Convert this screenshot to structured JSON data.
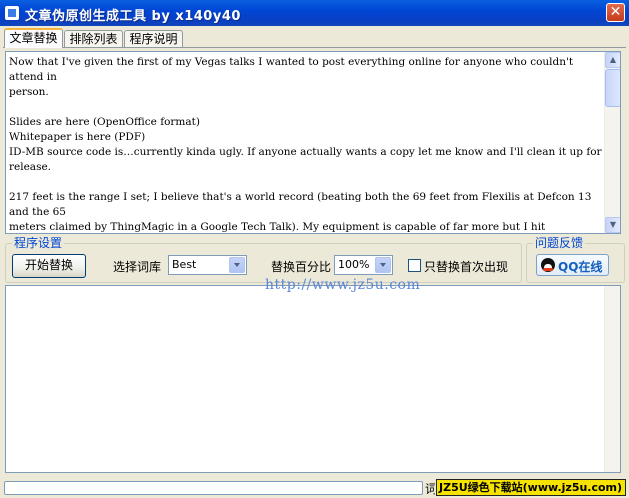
{
  "window": {
    "title": "文章伪原创生成工具 by x140y40",
    "close_glyph": "✕"
  },
  "tabs": [
    {
      "label": "文章替换",
      "active": true
    },
    {
      "label": "排除列表",
      "active": false
    },
    {
      "label": "程序说明",
      "active": false
    }
  ],
  "source_text": "Now that I've given the first of my Vegas talks I wanted to post everything online for anyone who couldn't attend in\nperson.\n\nSlides are here (OpenOffice format)\nWhitepaper is here (PDF)\nID-MB source code is…currently kinda ugly. If anyone actually wants a copy let me know and I'll clean it up for release.\n\n217 feet is the range I set; I believe that's a world record (beating both the 69 feet from Flexilis at Defcon 13 and the 65\nmeters claimed by ThingMagic in a Google Tech Talk). My equipment is capable of far more but I hit",
  "settings": {
    "group_title": "程序设置",
    "start_button": "开始替换",
    "word_select_label": "选择词库",
    "word_select_value": "Best",
    "percent_label": "替换百分比",
    "percent_value": "100%",
    "first_only_label": "只替换首次出现",
    "first_only_checked": false
  },
  "feedback": {
    "group_title": "问题反馈",
    "qq_button": "QQ在线"
  },
  "watermark": "http://www.jz5u.com",
  "status": {
    "label": "词",
    "banner": "JZ5U绿色下载站(www.jz5u.com)"
  },
  "colors": {
    "title_bar": "#0046d5",
    "group_title": "#0046d5",
    "banner_bg": "#f7e300"
  },
  "icons": {
    "app": "document-icon",
    "close": "close-icon",
    "qq": "qq-penguin-icon"
  }
}
